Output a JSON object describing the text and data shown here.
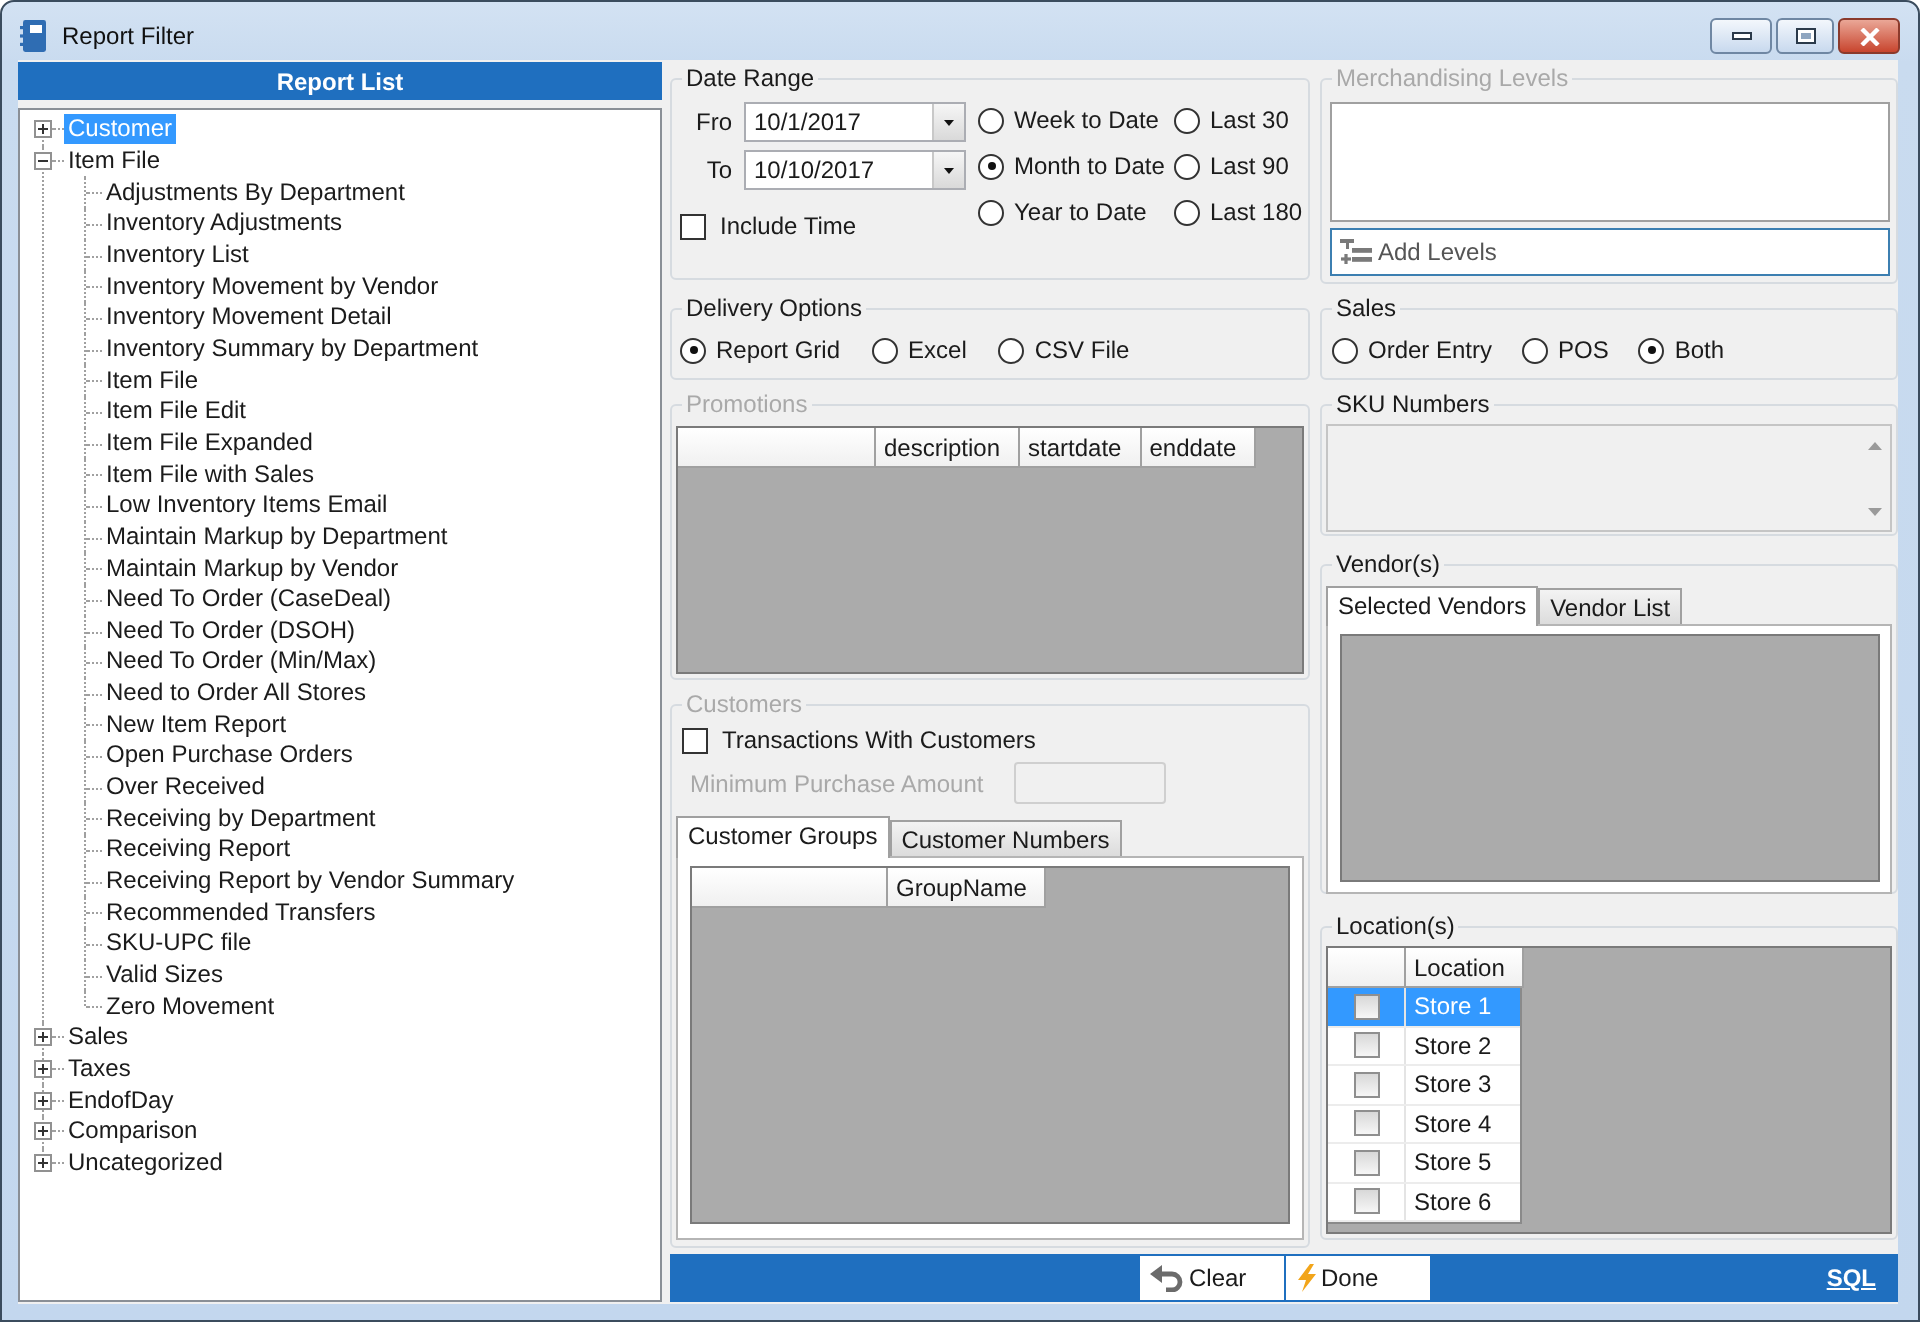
{
  "window": {
    "title": "Report Filter"
  },
  "report_list": {
    "header": "Report List",
    "items": [
      {
        "label": "Customer",
        "expanded": false,
        "selected": true
      },
      {
        "label": "Item File",
        "expanded": true,
        "selected": false,
        "children": [
          {
            "label": "Adjustments By Department",
            "selected": false
          },
          {
            "label": "Inventory Adjustments",
            "selected": false
          },
          {
            "label": "Inventory List",
            "selected": false
          },
          {
            "label": "Inventory Movement by Vendor",
            "selected": false
          },
          {
            "label": "Inventory Movement Detail",
            "selected": false
          },
          {
            "label": "Inventory Summary by Department",
            "selected": false
          },
          {
            "label": "Item File",
            "selected": false
          },
          {
            "label": "Item File Edit",
            "selected": false
          },
          {
            "label": "Item File Expanded",
            "selected": false
          },
          {
            "label": "Item File with Sales",
            "selected": false
          },
          {
            "label": "Low Inventory Items Email",
            "selected": false
          },
          {
            "label": "Maintain Markup by Department",
            "selected": false
          },
          {
            "label": "Maintain Markup by Vendor",
            "selected": false
          },
          {
            "label": "Need To Order (CaseDeal)",
            "selected": false
          },
          {
            "label": "Need To Order (DSOH)",
            "selected": false
          },
          {
            "label": "Need To Order (Min/Max)",
            "selected": false
          },
          {
            "label": "Need to Order All Stores",
            "selected": false
          },
          {
            "label": "New Item Report",
            "selected": false
          },
          {
            "label": "Open Purchase Orders",
            "selected": false
          },
          {
            "label": "Over Received",
            "selected": false
          },
          {
            "label": "Receiving by Department",
            "selected": false
          },
          {
            "label": "Receiving Report",
            "selected": false
          },
          {
            "label": "Receiving Report by Vendor Summary",
            "selected": false
          },
          {
            "label": "Recommended Transfers",
            "selected": false
          },
          {
            "label": "SKU-UPC file",
            "selected": false
          },
          {
            "label": "Valid Sizes",
            "selected": false
          },
          {
            "label": "Zero Movement",
            "selected": false
          }
        ]
      },
      {
        "label": "Sales",
        "expanded": false,
        "selected": false
      },
      {
        "label": "Taxes",
        "expanded": false,
        "selected": false
      },
      {
        "label": "EndofDay",
        "expanded": false,
        "selected": false
      },
      {
        "label": "Comparison",
        "expanded": false,
        "selected": false
      },
      {
        "label": "Uncategorized",
        "expanded": false,
        "selected": false
      }
    ]
  },
  "date_range": {
    "label": "Date Range",
    "disabled": false,
    "fields": [
      {
        "label": "Fro",
        "value": "10/1/2017"
      },
      {
        "label": "To",
        "value": "10/10/2017"
      }
    ],
    "include_time": {
      "label": "Include Time",
      "checked": false
    },
    "presets": [
      {
        "label": "Week to Date",
        "selected": false
      },
      {
        "label": "Last 30",
        "selected": false
      },
      {
        "label": "Month to Date",
        "selected": true
      },
      {
        "label": "Last 90",
        "selected": false
      },
      {
        "label": "Year to Date",
        "selected": false
      },
      {
        "label": "Last 180",
        "selected": false
      }
    ]
  },
  "delivery_options": {
    "label": "Delivery Options",
    "disabled": false,
    "options": [
      {
        "label": "Report Grid",
        "selected": true
      },
      {
        "label": "Excel",
        "selected": false
      },
      {
        "label": "CSV File",
        "selected": false
      }
    ]
  },
  "promotions": {
    "label": "Promotions",
    "disabled": true,
    "columns": [
      "description",
      "startdate",
      "enddate"
    ]
  },
  "customers": {
    "label": "Customers",
    "disabled": true,
    "transactions": {
      "label": "Transactions With Customers",
      "checked": false
    },
    "minimum_purchase": {
      "label": "Minimum Purchase Amount",
      "disabled": true
    },
    "tabs": [
      {
        "label": "Customer Groups",
        "selected": true
      },
      {
        "label": "Customer Numbers",
        "selected": false
      }
    ],
    "columns": [
      "GroupName"
    ]
  },
  "merchandising_levels": {
    "label": "Merchandising Levels",
    "disabled": true,
    "add_button": "Add Levels"
  },
  "sales": {
    "label": "Sales",
    "disabled": false,
    "options": [
      {
        "label": "Order Entry",
        "selected": false
      },
      {
        "label": "POS",
        "selected": false
      },
      {
        "label": "Both",
        "selected": true
      }
    ]
  },
  "sku_numbers": {
    "label": "SKU Numbers",
    "disabled": false
  },
  "vendors": {
    "label": "Vendor(s)",
    "disabled": false,
    "tabs": [
      {
        "label": "Selected Vendors",
        "selected": true
      },
      {
        "label": "Vendor List",
        "selected": false
      }
    ]
  },
  "locations": {
    "label": "Location(s)",
    "disabled": false,
    "columns": [
      "Location"
    ],
    "rows": [
      {
        "name": "Store 1",
        "checked": false,
        "selected": true
      },
      {
        "name": "Store 2",
        "checked": false,
        "selected": false
      },
      {
        "name": "Store 3",
        "checked": false,
        "selected": false
      },
      {
        "name": "Store 4",
        "checked": false,
        "selected": false
      },
      {
        "name": "Store 5",
        "checked": false,
        "selected": false
      },
      {
        "name": "Store 6",
        "checked": false,
        "selected": false
      }
    ]
  },
  "action_bar": {
    "buttons": [
      {
        "label": "Clear",
        "kind": "clear"
      },
      {
        "label": "Done",
        "kind": "done"
      }
    ],
    "link": "SQL"
  }
}
